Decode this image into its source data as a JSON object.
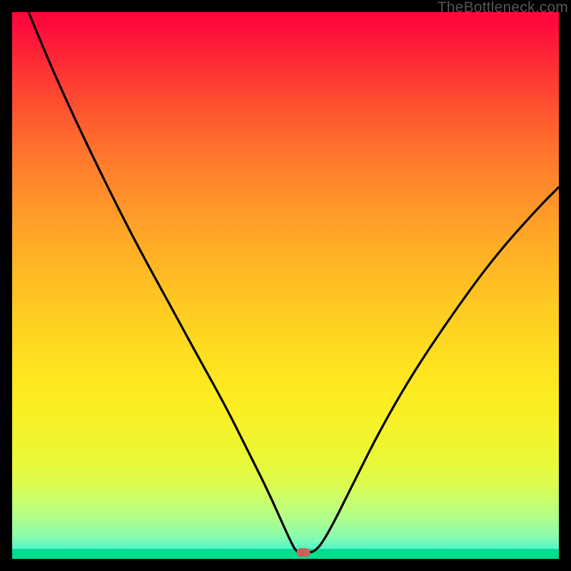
{
  "attribution": "TheBottleneck.com",
  "colors": {
    "frame_bg": "#000000",
    "curve": "#000000",
    "marker": "#cd5f5b",
    "green_strip": "#00dd8f"
  },
  "chart_data": {
    "type": "line",
    "title": "",
    "xlabel": "",
    "ylabel": "",
    "xlim": [
      0,
      100
    ],
    "ylim": [
      0,
      100
    ],
    "grid": false,
    "series": [
      {
        "name": "bottleneck-curve",
        "x": [
          3,
          8,
          15,
          22,
          28,
          34,
          39,
          43,
          46.5,
          49,
          50.8,
          52,
          53.2,
          55.5,
          58,
          62,
          67,
          73,
          80,
          88,
          96,
          100
        ],
        "y": [
          100,
          88,
          73,
          59,
          48,
          37,
          28,
          20,
          13,
          7.5,
          3.5,
          1.2,
          1.2,
          1.2,
          5,
          13,
          23,
          33.5,
          44,
          55,
          64,
          68
        ]
      }
    ],
    "marker": {
      "x": 53.2,
      "y": 1.2
    },
    "background": {
      "type": "vertical-gradient",
      "stops": [
        {
          "pos": 0.0,
          "color": "#fe093c"
        },
        {
          "pos": 0.3,
          "color": "#ff842b"
        },
        {
          "pos": 0.6,
          "color": "#fed821"
        },
        {
          "pos": 0.8,
          "color": "#eef631"
        },
        {
          "pos": 0.95,
          "color": "#88fcad"
        },
        {
          "pos": 1.0,
          "color": "#00dbec"
        }
      ],
      "bottom_strip": "#00dd8f"
    }
  }
}
